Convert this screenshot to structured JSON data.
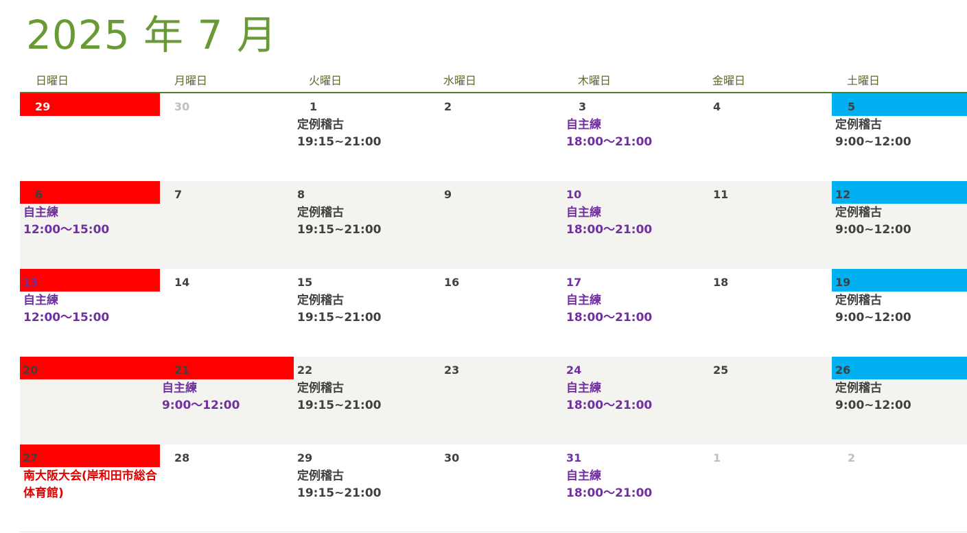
{
  "title": "2025 年 7 月",
  "weekdays": [
    "日曜日",
    "月曜日",
    "火曜日",
    "水曜日",
    "木曜日",
    "金曜日",
    "土曜日"
  ],
  "weeks": [
    {
      "days": [
        {
          "num": "29",
          "event": "",
          "time": ""
        },
        {
          "num": "30",
          "event": "",
          "time": ""
        },
        {
          "num": "1",
          "event": "定例稽古",
          "time": "19:15~21:00"
        },
        {
          "num": "2",
          "event": "",
          "time": ""
        },
        {
          "num": "3",
          "event": "自主練",
          "time": "18:00～21:00"
        },
        {
          "num": "4",
          "event": "",
          "time": ""
        },
        {
          "num": "5",
          "event": "定例稽古",
          "time": "9:00~12:00"
        }
      ]
    },
    {
      "days": [
        {
          "num": "6",
          "event": "自主練",
          "time": "12:00～15:00"
        },
        {
          "num": "7",
          "event": "",
          "time": ""
        },
        {
          "num": "8",
          "event": "定例稽古",
          "time": "19:15~21:00"
        },
        {
          "num": "9",
          "event": "",
          "time": ""
        },
        {
          "num": "10",
          "event": "自主練",
          "time": "18:00～21:00"
        },
        {
          "num": "11",
          "event": "",
          "time": ""
        },
        {
          "num": "12",
          "event": "定例稽古",
          "time": "9:00~12:00"
        }
      ]
    },
    {
      "days": [
        {
          "num": "13",
          "event": "自主練",
          "time": "12:00～15:00"
        },
        {
          "num": "14",
          "event": "",
          "time": ""
        },
        {
          "num": "15",
          "event": "定例稽古",
          "time": "19:15~21:00"
        },
        {
          "num": "16",
          "event": "",
          "time": ""
        },
        {
          "num": "17",
          "event": "自主練",
          "time": "18:00～21:00"
        },
        {
          "num": "18",
          "event": "",
          "time": ""
        },
        {
          "num": "19",
          "event": "定例稽古",
          "time": "9:00~12:00"
        }
      ]
    },
    {
      "days": [
        {
          "num": "20",
          "event": "",
          "time": ""
        },
        {
          "num": "21",
          "event": "自主練",
          "time": "9:00～12:00"
        },
        {
          "num": "22",
          "event": "定例稽古",
          "time": "19:15~21:00"
        },
        {
          "num": "23",
          "event": "",
          "time": ""
        },
        {
          "num": "24",
          "event": "自主練",
          "time": "18:00～21:00"
        },
        {
          "num": "25",
          "event": "",
          "time": ""
        },
        {
          "num": "26",
          "event": "定例稽古",
          "time": "9:00~12:00"
        }
      ]
    },
    {
      "days": [
        {
          "num": "27",
          "event": "南大阪大会(岸和田市総合体育館)",
          "time": ""
        },
        {
          "num": "28",
          "event": "",
          "time": ""
        },
        {
          "num": "29",
          "event": "定例稽古",
          "time": "19:15~21:00"
        },
        {
          "num": "30",
          "event": "",
          "time": ""
        },
        {
          "num": "31",
          "event": "自主練",
          "time": "18:00～21:00"
        },
        {
          "num": "1",
          "event": "",
          "time": ""
        },
        {
          "num": "2",
          "event": "",
          "time": ""
        }
      ]
    }
  ],
  "colors": {
    "title": "#6a9a35",
    "sunday_header": "#ff0000",
    "saturday_header": "#00b0f0",
    "practice_text": "#7030a0",
    "regular_text": "#404040",
    "tournament_text": "#e00000",
    "shaded_row": "#f3f3ef"
  }
}
